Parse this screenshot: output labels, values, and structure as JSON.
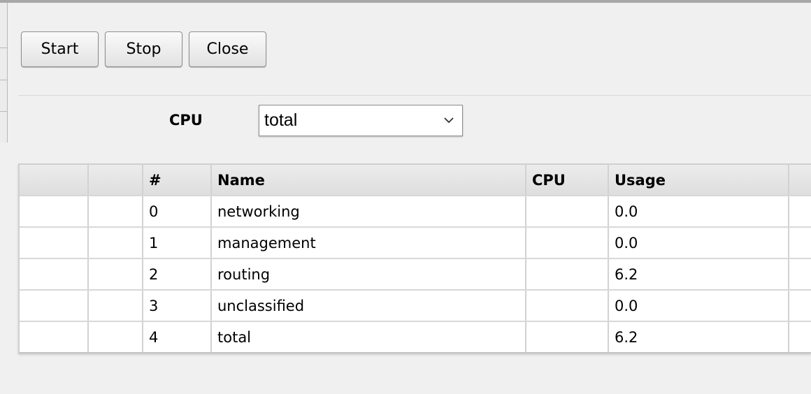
{
  "toolbar": {
    "start_label": "Start",
    "stop_label": "Stop",
    "close_label": "Close"
  },
  "filter": {
    "label": "CPU",
    "selected": "total"
  },
  "table": {
    "columns": [
      "",
      "",
      "#",
      "Name",
      "CPU",
      "Usage",
      ""
    ],
    "rows": [
      {
        "index": "0",
        "name": "networking",
        "cpu": "",
        "usage": "0.0"
      },
      {
        "index": "1",
        "name": "management",
        "cpu": "",
        "usage": "0.0"
      },
      {
        "index": "2",
        "name": "routing",
        "cpu": "",
        "usage": "6.2"
      },
      {
        "index": "3",
        "name": "unclassified",
        "cpu": "",
        "usage": "0.0"
      },
      {
        "index": "4",
        "name": "total",
        "cpu": "",
        "usage": "6.2"
      }
    ]
  },
  "icons": {
    "select_caret": "chevron-down-icon"
  }
}
